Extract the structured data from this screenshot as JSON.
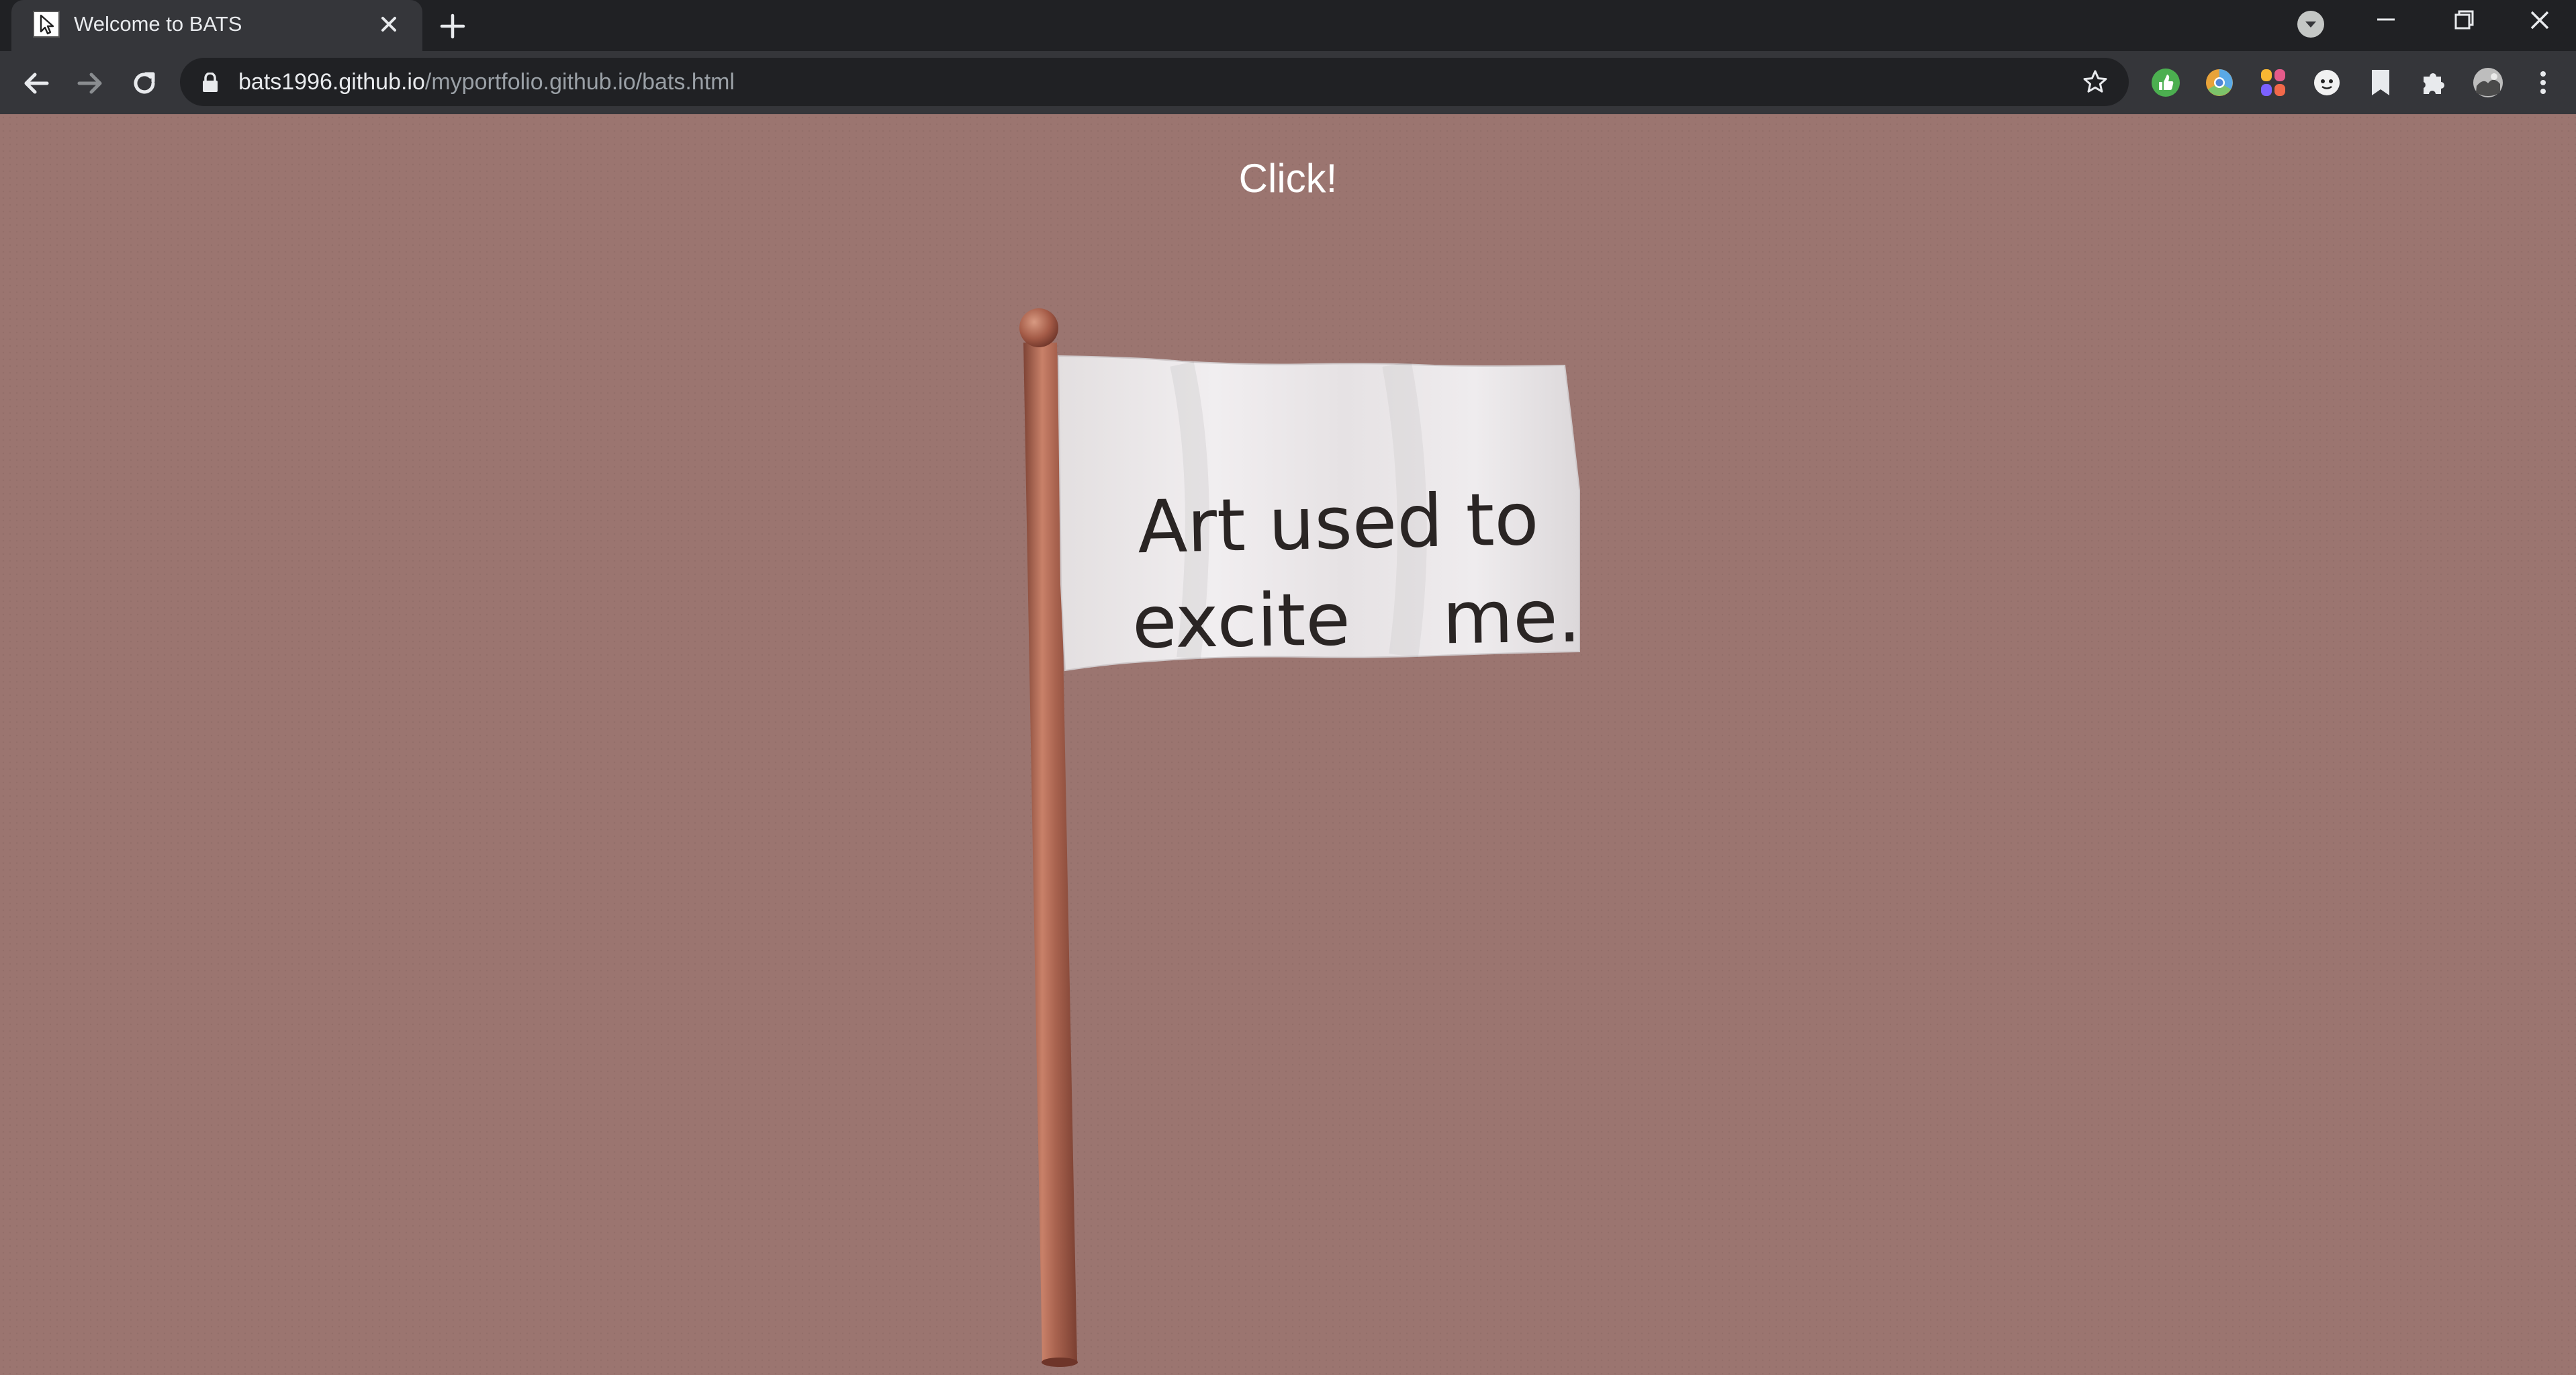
{
  "browser": {
    "tab": {
      "title": "Welcome to BATS",
      "favicon": "cursor-favicon-icon"
    },
    "url": {
      "host": "bats1996.github.io",
      "path": "/myportfolio.github.io/bats.html"
    },
    "extensions": [
      "green-thumb-extension-icon",
      "chrome-color-extension-icon",
      "colorful-grid-extension-icon",
      "face-extension-icon",
      "bookmark-extension-icon",
      "puzzle-extensions-icon"
    ],
    "profile": "profile-avatar-icon"
  },
  "page": {
    "click_label": "Click!",
    "flag": {
      "line1": "Art used to",
      "line2": "excite    me."
    }
  },
  "colors": {
    "background": "#9b7570",
    "pole": "#a5624e",
    "flag_cloth": "#ece9ea",
    "flag_text": "#2a2524"
  }
}
